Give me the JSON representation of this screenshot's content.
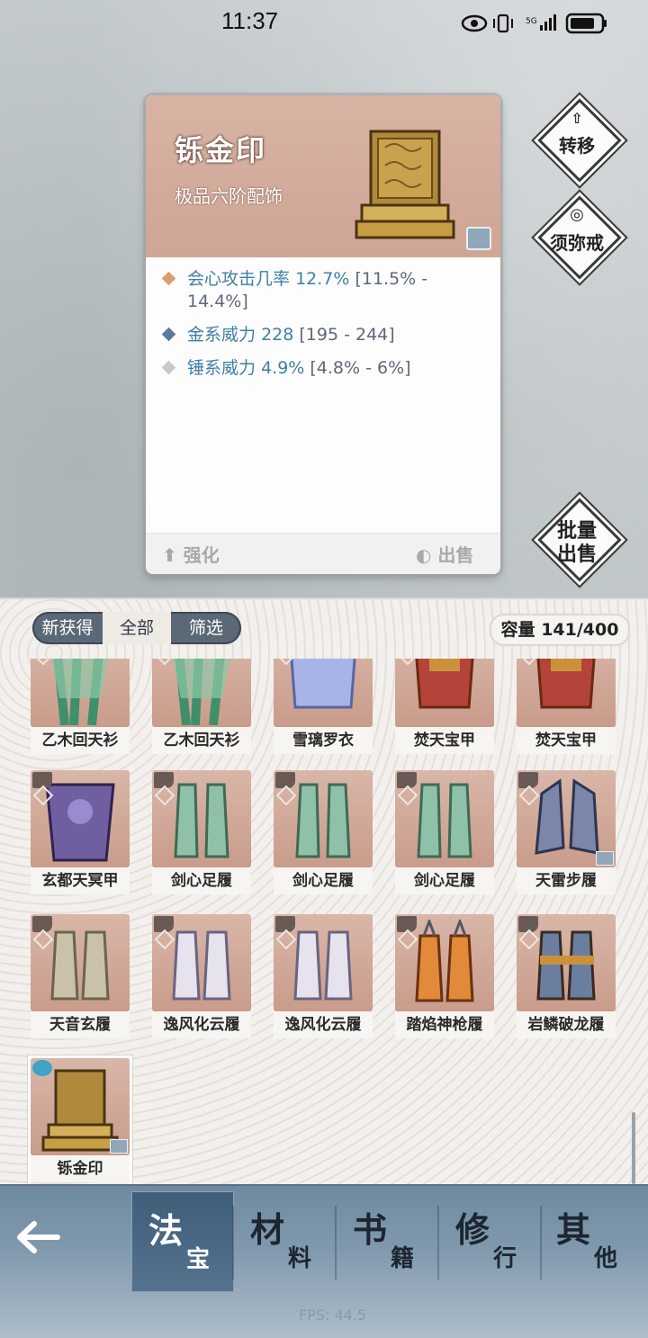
{
  "status_bar": {
    "time": "11:37",
    "network": "5G"
  },
  "item": {
    "name": "铄金印",
    "subtitle": "极品六阶配饰",
    "stats": [
      {
        "label": "会心攻击几率",
        "value": "12.7%",
        "range": "[11.5% - 14.4%]",
        "color": "#d9a06a"
      },
      {
        "label": "金系威力",
        "value": "228",
        "range": "[195 - 244]",
        "color": "#5b7a9a"
      },
      {
        "label": "锤系威力",
        "value": "4.9%",
        "range": "[4.8% - 6%]",
        "color": "#c8c8c8"
      }
    ],
    "enhance_label": "强化",
    "sell_label": "出售"
  },
  "side_buttons": {
    "transfer": "转移",
    "sumeru": "须弥戒",
    "batch_sell_line1": "批量",
    "batch_sell_line2": "出售"
  },
  "inventory": {
    "tabs": [
      "新获得",
      "全部",
      "筛选"
    ],
    "active_tab": "全部",
    "capacity_label": "容量",
    "capacity": "141/400",
    "items": [
      {
        "name": "乙木回天衫"
      },
      {
        "name": "乙木回天衫"
      },
      {
        "name": "雪璃罗衣"
      },
      {
        "name": "焚天宝甲"
      },
      {
        "name": "焚天宝甲"
      },
      {
        "name": "玄都天冥甲"
      },
      {
        "name": "剑心足履"
      },
      {
        "name": "剑心足履"
      },
      {
        "name": "剑心足履"
      },
      {
        "name": "天雷步履"
      },
      {
        "name": "天音玄履"
      },
      {
        "name": "逸风化云履"
      },
      {
        "name": "逸风化云履"
      },
      {
        "name": "踏焰神枪履"
      },
      {
        "name": "岩鳞破龙履"
      },
      {
        "name": "铄金印"
      }
    ]
  },
  "bottom_nav": {
    "tabs": [
      {
        "big": "法",
        "small": "宝"
      },
      {
        "big": "材",
        "small": "料"
      },
      {
        "big": "书",
        "small": "籍"
      },
      {
        "big": "修",
        "small": "行"
      },
      {
        "big": "其",
        "small": "他"
      }
    ],
    "active_index": 0
  },
  "fps_text": "FPS: 44.5"
}
